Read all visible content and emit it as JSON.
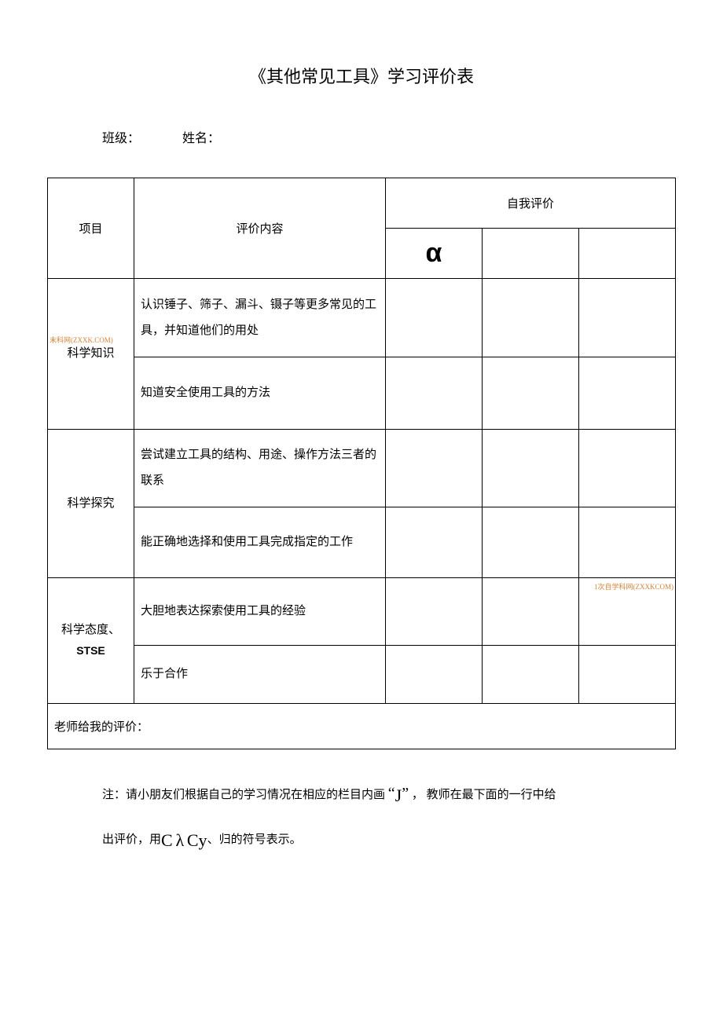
{
  "title": "《其他常见工具》学习评价表",
  "info": {
    "class_label": "班级：",
    "name_label": "姓名："
  },
  "headers": {
    "project": "项目",
    "content": "评价内容",
    "self_eval": "自我评价",
    "alpha": "α"
  },
  "rows": [
    {
      "project": "科学知识",
      "items": [
        "认识锤子、筛子、漏斗、镊子等更多常见的工具，并知道他们的用处",
        "知道安全使用工具的方法"
      ]
    },
    {
      "project": "科学探究",
      "items": [
        "尝试建立工具的结构、用途、操作方法三者的联系",
        "能正确地选择和使用工具完成指定的工作"
      ]
    },
    {
      "project_line1": "科学态度、",
      "project_line2": "STSE",
      "items": [
        "大胆地表达探索使用工具的经验",
        "乐于合作"
      ]
    }
  ],
  "teacher_row": "老师给我的评价：",
  "note": {
    "part1": "注：请小朋友们根据自己的学习情况在相应的栏目内画",
    "quote_open": "“",
    "symbol_j": "J",
    "quote_close": "”",
    "comma": "，",
    "part2": " 教师在最下面的一行中给",
    "part3": "出评价，用",
    "symbol_c1": "C",
    "symbol_lambda": "λ",
    "symbol_cy": "Cy",
    "part4": "、归的符号表示。"
  },
  "watermarks": {
    "wm1": "末科网(ZXXK.COM)",
    "wm2": "1次自学科网(ZXXKCOM)"
  }
}
